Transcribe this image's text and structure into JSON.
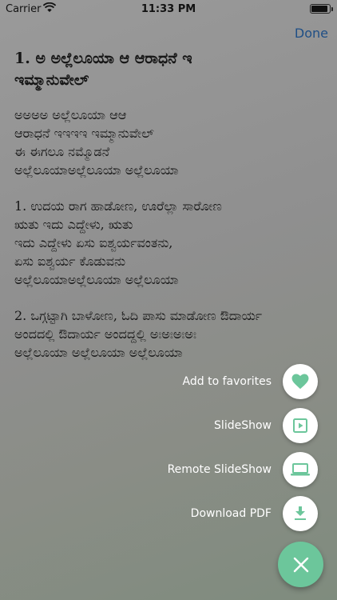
{
  "status_bar": {
    "carrier": "Carrier",
    "time": "11:33 PM"
  },
  "nav": {
    "done_label": "Done"
  },
  "song": {
    "title": "1. ಅ ಅಲ್ಲೆಲೂಯಾ ಆ ಆರಾಧನೆ ಇ ಇಮ್ಮಾನುವೇಲ್",
    "stanzas": [
      [
        "ಅಅಅಅ ಅಲ್ಲೆಲೂಯಾ ಆಆ",
        "ಆರಾಧನೆ ಇಇಇಇ ಇಮ್ಮಾನುವೇಲ್",
        "ಈ ಈಗಲೂ ನಮ್ಮೊಡನೆ",
        "ಅಲ್ಲೆಲೂಯಾಅಲ್ಲೆಲೂಯಾ ಅಲ್ಲೆಲೂಯಾ"
      ],
      [
        "1. ಉದಯ ರಾಗ ಹಾಡೋಣ, ಊರೆಲ್ಲಾ ಸಾರೋಣ",
        "ಋತು ಇದು ಎದ್ದೇಳು, ಋತು",
        "ಇದು ಎದ್ದೇಳು ಏಸು ಐಶ್ವರ್ಯವಂತನು,",
        "ಏಸು ಐಶ್ವರ್ಯ ಕೊಡುವನು",
        "ಅಲ್ಲೆಲೂಯಾಅಲ್ಲೆಲೂಯಾ ಅಲ್ಲೆಲೂಯಾ"
      ],
      [
        "2. ಒಗ್ಗಟ್ಟಾಗಿ ಬಾಳೋಣ, ಓದಿ ಪಾಸು ಮಾಡೋಣ ಔದಾರ್ಯ",
        "ಅಂದದಲ್ಲಿ ಔದಾರ್ಯ ಅಂದದ್ದಲ್ಲಿ ಅಃಅಃಅಃಅಃ",
        "ಅಲ್ಲೆಲೂಯಾ ಅಲ್ಲೆಲೂಯಾ ಅಲ್ಲೆಲೂಯಾ"
      ]
    ]
  },
  "actions": {
    "favorites": "Add to favorites",
    "slideshow": "SlideShow",
    "remote_slideshow": "Remote SlideShow",
    "download_pdf": "Download PDF"
  },
  "colors": {
    "accent_green": "#6cc69b",
    "link_blue": "#1f4f86"
  },
  "icons": [
    "wifi-icon",
    "battery-icon",
    "heart-icon",
    "play-icon",
    "laptop-icon",
    "download-icon",
    "close-icon"
  ]
}
